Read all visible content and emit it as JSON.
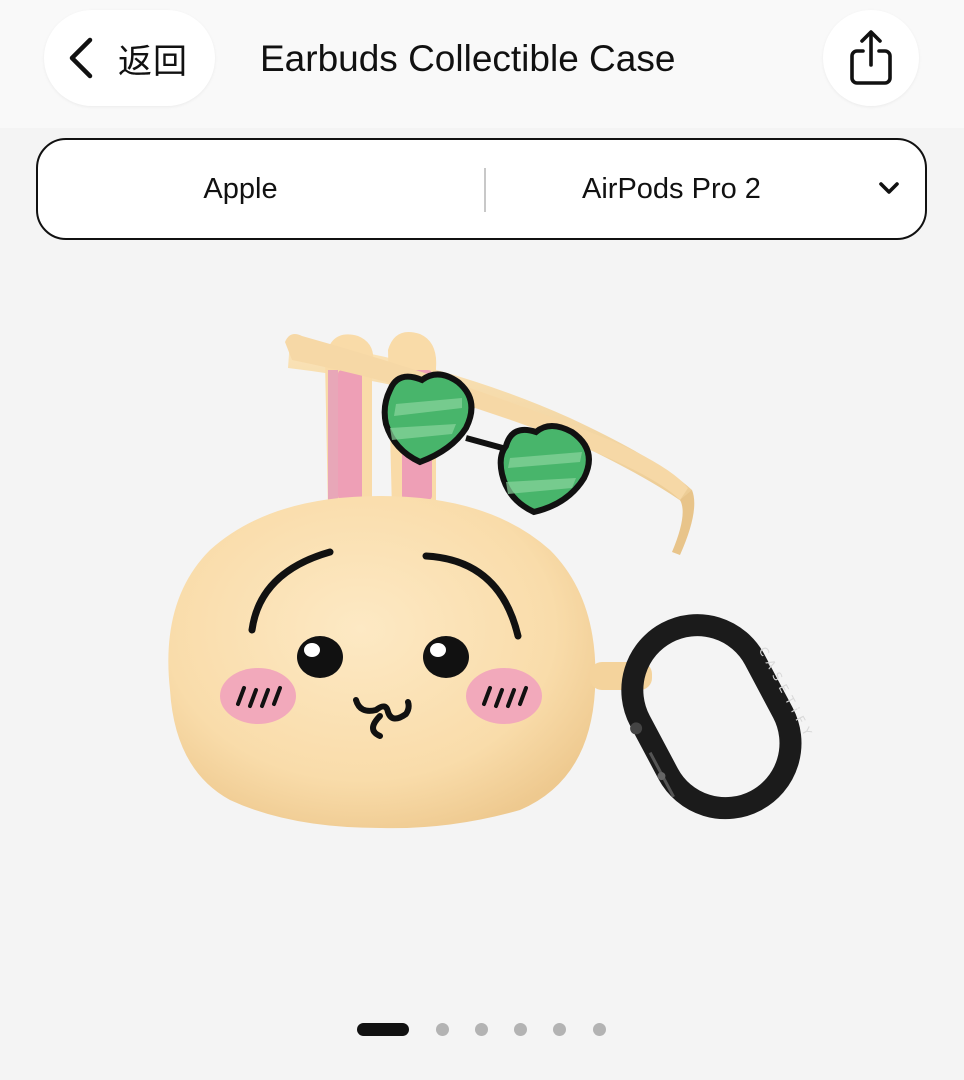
{
  "header": {
    "back_label": "返回",
    "title": "Earbuds Collectible Case"
  },
  "selector": {
    "brand": "Apple",
    "model": "AirPods Pro 2"
  },
  "product_image": {
    "description_icon": "bunny-earbuds-case-image",
    "ring_text": "CASETiFY"
  },
  "pager": {
    "total": 6,
    "current": 1
  },
  "colors": {
    "background": "#f4f4f4",
    "case_body": "#fbe2b6",
    "blush": "#f2a9bb",
    "lens_green": "#3fae63",
    "ring_black": "#1b1b1b"
  }
}
